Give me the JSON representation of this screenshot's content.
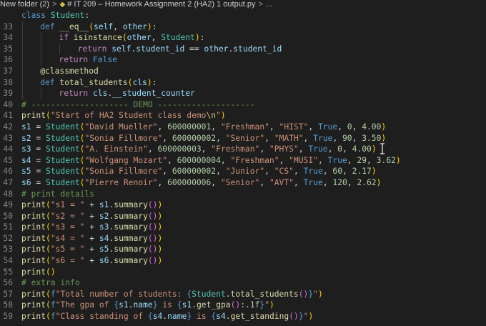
{
  "breadcrumb": {
    "folder": "New folder (2)",
    "separator": ">",
    "file": "# IT 209 – Homework Assignment 2 (HA2) 1 output.py",
    "trail": "...",
    "file_icon": "python-file-icon"
  },
  "colors": {
    "background": "#1e1e1e",
    "keyword": "#569cd6",
    "control": "#c586c0",
    "class": "#4ec9b0",
    "function": "#dcdcaa",
    "string": "#ce9178",
    "number": "#b5cea8",
    "variable": "#9cdcfe",
    "comment": "#6a9955"
  },
  "lines": [
    {
      "num": "",
      "indent": 0,
      "tokens": [
        {
          "t": "class ",
          "c": "kw"
        },
        {
          "t": "Student",
          "c": "cls"
        },
        {
          "t": ":",
          "c": "pu"
        }
      ]
    },
    {
      "num": "33",
      "indent": 1,
      "tokens": [
        {
          "t": "def ",
          "c": "kw"
        },
        {
          "t": "__eq__",
          "c": "fn"
        },
        {
          "t": "(",
          "c": "p1"
        },
        {
          "t": "self",
          "c": "self"
        },
        {
          "t": ", ",
          "c": "pu"
        },
        {
          "t": "other",
          "c": "var"
        },
        {
          "t": ")",
          "c": "p1"
        },
        {
          "t": ":",
          "c": "pu"
        }
      ]
    },
    {
      "num": "34",
      "indent": 2,
      "tokens": [
        {
          "t": "if ",
          "c": "ctl"
        },
        {
          "t": "isinstance",
          "c": "fn"
        },
        {
          "t": "(",
          "c": "p1"
        },
        {
          "t": "other",
          "c": "var"
        },
        {
          "t": ", ",
          "c": "pu"
        },
        {
          "t": "Student",
          "c": "cls"
        },
        {
          "t": ")",
          "c": "p1"
        },
        {
          "t": ":",
          "c": "pu"
        }
      ]
    },
    {
      "num": "35",
      "indent": 3,
      "tokens": [
        {
          "t": "return ",
          "c": "ctl"
        },
        {
          "t": "self",
          "c": "self"
        },
        {
          "t": ".",
          "c": "pu"
        },
        {
          "t": "student_id",
          "c": "var"
        },
        {
          "t": " == ",
          "c": "pu"
        },
        {
          "t": "other",
          "c": "var"
        },
        {
          "t": ".",
          "c": "pu"
        },
        {
          "t": "student_id",
          "c": "var"
        }
      ]
    },
    {
      "num": "36",
      "indent": 2,
      "tokens": [
        {
          "t": "return ",
          "c": "ctl"
        },
        {
          "t": "False",
          "c": "bool"
        }
      ]
    },
    {
      "num": "37",
      "indent": 1,
      "tokens": [
        {
          "t": "@classmethod",
          "c": "dec"
        }
      ]
    },
    {
      "num": "38",
      "indent": 1,
      "tokens": [
        {
          "t": "def ",
          "c": "kw"
        },
        {
          "t": "total_students",
          "c": "fn"
        },
        {
          "t": "(",
          "c": "p1"
        },
        {
          "t": "cls",
          "c": "var"
        },
        {
          "t": ")",
          "c": "p1"
        },
        {
          "t": ":",
          "c": "pu"
        }
      ]
    },
    {
      "num": "39",
      "indent": 2,
      "tokens": [
        {
          "t": "return ",
          "c": "ctl"
        },
        {
          "t": "cls",
          "c": "var"
        },
        {
          "t": ".",
          "c": "pu"
        },
        {
          "t": "__student_counter",
          "c": "var"
        }
      ]
    },
    {
      "num": "40",
      "indent": 0,
      "tokens": [
        {
          "t": "# -------------------- DEMO --------------------",
          "c": "cmt"
        }
      ]
    },
    {
      "num": "41",
      "indent": 0,
      "tokens": [
        {
          "t": "print",
          "c": "fn"
        },
        {
          "t": "(",
          "c": "p1"
        },
        {
          "t": "\"Start of HA2 Student class demo",
          "c": "str"
        },
        {
          "t": "\\n",
          "c": "esc"
        },
        {
          "t": "\"",
          "c": "str"
        },
        {
          "t": ")",
          "c": "p1"
        }
      ]
    },
    {
      "num": "42",
      "indent": 0,
      "tokens": [
        {
          "t": "s1",
          "c": "var"
        },
        {
          "t": " = ",
          "c": "pu"
        },
        {
          "t": "Student",
          "c": "cls"
        },
        {
          "t": "(",
          "c": "p1"
        },
        {
          "t": "\"David Mueller\"",
          "c": "str"
        },
        {
          "t": ", ",
          "c": "pu"
        },
        {
          "t": "600000001",
          "c": "num"
        },
        {
          "t": ", ",
          "c": "pu"
        },
        {
          "t": "\"Freshman\"",
          "c": "str"
        },
        {
          "t": ", ",
          "c": "pu"
        },
        {
          "t": "\"HIST\"",
          "c": "str"
        },
        {
          "t": ", ",
          "c": "pu"
        },
        {
          "t": "True",
          "c": "bool"
        },
        {
          "t": ", ",
          "c": "pu"
        },
        {
          "t": "0",
          "c": "num"
        },
        {
          "t": ", ",
          "c": "pu"
        },
        {
          "t": "4.00",
          "c": "num"
        },
        {
          "t": ")",
          "c": "p1"
        }
      ]
    },
    {
      "num": "43",
      "indent": 0,
      "tokens": [
        {
          "t": "s2",
          "c": "var"
        },
        {
          "t": " = ",
          "c": "pu"
        },
        {
          "t": "Student",
          "c": "cls"
        },
        {
          "t": "(",
          "c": "p1"
        },
        {
          "t": "\"Sonia Fillmore\"",
          "c": "str"
        },
        {
          "t": ", ",
          "c": "pu"
        },
        {
          "t": "600000002",
          "c": "num"
        },
        {
          "t": ", ",
          "c": "pu"
        },
        {
          "t": "\"Senior\"",
          "c": "str"
        },
        {
          "t": ", ",
          "c": "pu"
        },
        {
          "t": "\"MATH\"",
          "c": "str"
        },
        {
          "t": ", ",
          "c": "pu"
        },
        {
          "t": "True",
          "c": "bool"
        },
        {
          "t": ", ",
          "c": "pu"
        },
        {
          "t": "90",
          "c": "num"
        },
        {
          "t": ", ",
          "c": "pu"
        },
        {
          "t": "3.50",
          "c": "num"
        },
        {
          "t": ")",
          "c": "p1"
        }
      ]
    },
    {
      "num": "44",
      "indent": 0,
      "tokens": [
        {
          "t": "s3",
          "c": "var"
        },
        {
          "t": " = ",
          "c": "pu"
        },
        {
          "t": "Student",
          "c": "cls"
        },
        {
          "t": "(",
          "c": "p1"
        },
        {
          "t": "\"A. Einstein\"",
          "c": "str"
        },
        {
          "t": ", ",
          "c": "pu"
        },
        {
          "t": "600000003",
          "c": "num"
        },
        {
          "t": ", ",
          "c": "pu"
        },
        {
          "t": "\"Freshman\"",
          "c": "str"
        },
        {
          "t": ", ",
          "c": "pu"
        },
        {
          "t": "\"PHYS\"",
          "c": "str"
        },
        {
          "t": ", ",
          "c": "pu"
        },
        {
          "t": "True",
          "c": "bool"
        },
        {
          "t": ", ",
          "c": "pu"
        },
        {
          "t": "0",
          "c": "num"
        },
        {
          "t": ", ",
          "c": "pu"
        },
        {
          "t": "4.00",
          "c": "num"
        },
        {
          "t": ")",
          "c": "p1"
        }
      ]
    },
    {
      "num": "45",
      "indent": 0,
      "tokens": [
        {
          "t": "s4",
          "c": "var"
        },
        {
          "t": " = ",
          "c": "pu"
        },
        {
          "t": "Student",
          "c": "cls"
        },
        {
          "t": "(",
          "c": "p1"
        },
        {
          "t": "\"Wolfgang Mozart\"",
          "c": "str"
        },
        {
          "t": ", ",
          "c": "pu"
        },
        {
          "t": "600000004",
          "c": "num"
        },
        {
          "t": ", ",
          "c": "pu"
        },
        {
          "t": "\"Freshman\"",
          "c": "str"
        },
        {
          "t": ", ",
          "c": "pu"
        },
        {
          "t": "\"MUSI\"",
          "c": "str"
        },
        {
          "t": ", ",
          "c": "pu"
        },
        {
          "t": "True",
          "c": "bool"
        },
        {
          "t": ", ",
          "c": "pu"
        },
        {
          "t": "29",
          "c": "num"
        },
        {
          "t": ", ",
          "c": "pu"
        },
        {
          "t": "3.62",
          "c": "num"
        },
        {
          "t": ")",
          "c": "p1"
        }
      ]
    },
    {
      "num": "46",
      "indent": 0,
      "tokens": [
        {
          "t": "s5",
          "c": "var"
        },
        {
          "t": " = ",
          "c": "pu"
        },
        {
          "t": "Student",
          "c": "cls"
        },
        {
          "t": "(",
          "c": "p1"
        },
        {
          "t": "\"Sonia Fillmore\"",
          "c": "str"
        },
        {
          "t": ", ",
          "c": "pu"
        },
        {
          "t": "600000002",
          "c": "num"
        },
        {
          "t": ", ",
          "c": "pu"
        },
        {
          "t": "\"Junior\"",
          "c": "str"
        },
        {
          "t": ", ",
          "c": "pu"
        },
        {
          "t": "\"CS\"",
          "c": "str"
        },
        {
          "t": ", ",
          "c": "pu"
        },
        {
          "t": "True",
          "c": "bool"
        },
        {
          "t": ", ",
          "c": "pu"
        },
        {
          "t": "60",
          "c": "num"
        },
        {
          "t": ", ",
          "c": "pu"
        },
        {
          "t": "2.17",
          "c": "num"
        },
        {
          "t": ")",
          "c": "p1"
        }
      ]
    },
    {
      "num": "47",
      "indent": 0,
      "tokens": [
        {
          "t": "s6",
          "c": "var"
        },
        {
          "t": " = ",
          "c": "pu"
        },
        {
          "t": "Student",
          "c": "cls"
        },
        {
          "t": "(",
          "c": "p1"
        },
        {
          "t": "\"Pierre Renoir\"",
          "c": "str"
        },
        {
          "t": ", ",
          "c": "pu"
        },
        {
          "t": "600000006",
          "c": "num"
        },
        {
          "t": ", ",
          "c": "pu"
        },
        {
          "t": "\"Senior\"",
          "c": "str"
        },
        {
          "t": ", ",
          "c": "pu"
        },
        {
          "t": "\"AVT\"",
          "c": "str"
        },
        {
          "t": ", ",
          "c": "pu"
        },
        {
          "t": "True",
          "c": "bool"
        },
        {
          "t": ", ",
          "c": "pu"
        },
        {
          "t": "120",
          "c": "num"
        },
        {
          "t": ", ",
          "c": "pu"
        },
        {
          "t": "2.62",
          "c": "num"
        },
        {
          "t": ")",
          "c": "p1"
        }
      ]
    },
    {
      "num": "48",
      "indent": 0,
      "tokens": [
        {
          "t": "# print details",
          "c": "cmt"
        }
      ]
    },
    {
      "num": "49",
      "indent": 0,
      "tokens": [
        {
          "t": "print",
          "c": "fn"
        },
        {
          "t": "(",
          "c": "p1"
        },
        {
          "t": "\"s1 = \"",
          "c": "str"
        },
        {
          "t": " + ",
          "c": "pu"
        },
        {
          "t": "s1",
          "c": "var"
        },
        {
          "t": ".",
          "c": "pu"
        },
        {
          "t": "summary",
          "c": "fn"
        },
        {
          "t": "()",
          "c": "p2"
        },
        {
          "t": ")",
          "c": "p1"
        }
      ]
    },
    {
      "num": "50",
      "indent": 0,
      "tokens": [
        {
          "t": "print",
          "c": "fn"
        },
        {
          "t": "(",
          "c": "p1"
        },
        {
          "t": "\"s2 = \"",
          "c": "str"
        },
        {
          "t": " + ",
          "c": "pu"
        },
        {
          "t": "s2",
          "c": "var"
        },
        {
          "t": ".",
          "c": "pu"
        },
        {
          "t": "summary",
          "c": "fn"
        },
        {
          "t": "()",
          "c": "p2"
        },
        {
          "t": ")",
          "c": "p1"
        }
      ]
    },
    {
      "num": "51",
      "indent": 0,
      "tokens": [
        {
          "t": "print",
          "c": "fn"
        },
        {
          "t": "(",
          "c": "p1"
        },
        {
          "t": "\"s3 = \"",
          "c": "str"
        },
        {
          "t": " + ",
          "c": "pu"
        },
        {
          "t": "s3",
          "c": "var"
        },
        {
          "t": ".",
          "c": "pu"
        },
        {
          "t": "summary",
          "c": "fn"
        },
        {
          "t": "()",
          "c": "p2"
        },
        {
          "t": ")",
          "c": "p1"
        }
      ]
    },
    {
      "num": "52",
      "indent": 0,
      "tokens": [
        {
          "t": "print",
          "c": "fn"
        },
        {
          "t": "(",
          "c": "p1"
        },
        {
          "t": "\"s4 = \"",
          "c": "str"
        },
        {
          "t": " + ",
          "c": "pu"
        },
        {
          "t": "s4",
          "c": "var"
        },
        {
          "t": ".",
          "c": "pu"
        },
        {
          "t": "summary",
          "c": "fn"
        },
        {
          "t": "()",
          "c": "p2"
        },
        {
          "t": ")",
          "c": "p1"
        }
      ]
    },
    {
      "num": "53",
      "indent": 0,
      "tokens": [
        {
          "t": "print",
          "c": "fn"
        },
        {
          "t": "(",
          "c": "p1"
        },
        {
          "t": "\"s5 = \"",
          "c": "str"
        },
        {
          "t": " + ",
          "c": "pu"
        },
        {
          "t": "s5",
          "c": "var"
        },
        {
          "t": ".",
          "c": "pu"
        },
        {
          "t": "summary",
          "c": "fn"
        },
        {
          "t": "()",
          "c": "p2"
        },
        {
          "t": ")",
          "c": "p1"
        }
      ]
    },
    {
      "num": "54",
      "indent": 0,
      "tokens": [
        {
          "t": "print",
          "c": "fn"
        },
        {
          "t": "(",
          "c": "p1"
        },
        {
          "t": "\"s6 = \"",
          "c": "str"
        },
        {
          "t": " + ",
          "c": "pu"
        },
        {
          "t": "s6",
          "c": "var"
        },
        {
          "t": ".",
          "c": "pu"
        },
        {
          "t": "summary",
          "c": "fn"
        },
        {
          "t": "()",
          "c": "p2"
        },
        {
          "t": ")",
          "c": "p1"
        }
      ]
    },
    {
      "num": "55",
      "indent": 0,
      "tokens": [
        {
          "t": "print",
          "c": "fn"
        },
        {
          "t": "()",
          "c": "p1"
        }
      ]
    },
    {
      "num": "56",
      "indent": 0,
      "tokens": [
        {
          "t": "# extra info",
          "c": "cmt"
        }
      ]
    },
    {
      "num": "57",
      "indent": 0,
      "tokens": [
        {
          "t": "print",
          "c": "fn"
        },
        {
          "t": "(",
          "c": "p1"
        },
        {
          "t": "f",
          "c": "fs"
        },
        {
          "t": "\"Total number of students: ",
          "c": "str"
        },
        {
          "t": "{",
          "c": "fs"
        },
        {
          "t": "Student",
          "c": "cls"
        },
        {
          "t": ".",
          "c": "pu"
        },
        {
          "t": "total_students",
          "c": "fn"
        },
        {
          "t": "()",
          "c": "p2"
        },
        {
          "t": "}",
          "c": "fs"
        },
        {
          "t": "\"",
          "c": "str"
        },
        {
          "t": ")",
          "c": "p1"
        }
      ]
    },
    {
      "num": "58",
      "indent": 0,
      "tokens": [
        {
          "t": "print",
          "c": "fn"
        },
        {
          "t": "(",
          "c": "p1"
        },
        {
          "t": "f",
          "c": "fs"
        },
        {
          "t": "\"The gpa of ",
          "c": "str"
        },
        {
          "t": "{",
          "c": "fs"
        },
        {
          "t": "s1",
          "c": "var"
        },
        {
          "t": ".",
          "c": "pu"
        },
        {
          "t": "name",
          "c": "var"
        },
        {
          "t": "}",
          "c": "fs"
        },
        {
          "t": " is ",
          "c": "str"
        },
        {
          "t": "{",
          "c": "fs"
        },
        {
          "t": "s1",
          "c": "var"
        },
        {
          "t": ".",
          "c": "pu"
        },
        {
          "t": "get_gpa",
          "c": "fn"
        },
        {
          "t": "()",
          "c": "p2"
        },
        {
          "t": ":.1f",
          "c": "num"
        },
        {
          "t": "}",
          "c": "fs"
        },
        {
          "t": "\"",
          "c": "str"
        },
        {
          "t": ")",
          "c": "p1"
        }
      ]
    },
    {
      "num": "59",
      "indent": 0,
      "tokens": [
        {
          "t": "print",
          "c": "fn"
        },
        {
          "t": "(",
          "c": "p1"
        },
        {
          "t": "f",
          "c": "fs"
        },
        {
          "t": "\"Class standing of ",
          "c": "str"
        },
        {
          "t": "{",
          "c": "fs"
        },
        {
          "t": "s4",
          "c": "var"
        },
        {
          "t": ".",
          "c": "pu"
        },
        {
          "t": "name",
          "c": "var"
        },
        {
          "t": "}",
          "c": "fs"
        },
        {
          "t": " is ",
          "c": "str"
        },
        {
          "t": "{",
          "c": "fs"
        },
        {
          "t": "s4",
          "c": "var"
        },
        {
          "t": ".",
          "c": "pu"
        },
        {
          "t": "get_standing",
          "c": "fn"
        },
        {
          "t": "()",
          "c": "p2"
        },
        {
          "t": "}",
          "c": "fs"
        },
        {
          "t": "\"",
          "c": "str"
        },
        {
          "t": ")",
          "c": "p1"
        }
      ]
    }
  ]
}
